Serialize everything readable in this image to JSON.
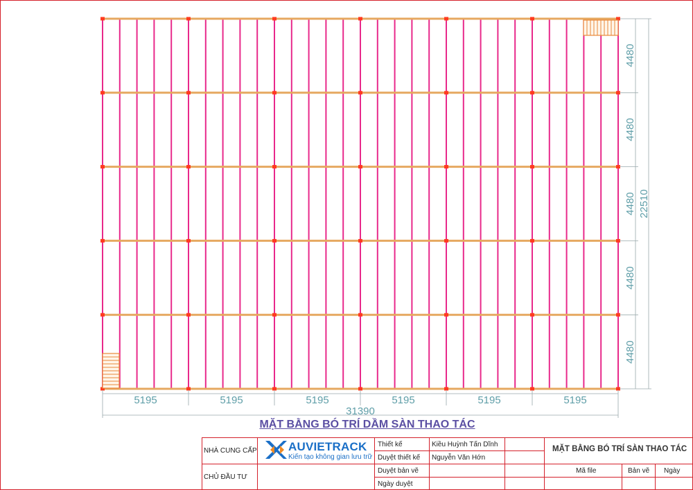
{
  "drawing": {
    "title": "MẶT BẰNG BÓ TRÍ DẦM SÀN THAO TÁC",
    "bay_widths": [
      "5195",
      "5195",
      "5195",
      "5195",
      "5195",
      "5195"
    ],
    "total_width": "31390",
    "row_heights": [
      "4480",
      "4480",
      "4480",
      "4480",
      "4480"
    ],
    "total_height": "22510",
    "colors": {
      "joist": "#e8288a",
      "beam": "#e6a860",
      "node": "#ff3b1f",
      "dimension": "#5f9ea8",
      "stair": "#e8883a"
    }
  },
  "title_block": {
    "supplier_label": "NHÀ CUNG CẤP",
    "investor_label": "CHỦ ĐẦU TƯ",
    "logo_name": "AUVIETRACK",
    "logo_tagline": "Kiến tạo không gian lưu trữ",
    "design_label": "Thiết kế",
    "design_value": "Kiều Huỳnh Tấn Dĩnh",
    "approve_design_label": "Duyệt thiết kế",
    "approve_design_value": "Nguyễn Văn Hớn",
    "approve_drawing_label": "Duyệt bản vẽ",
    "approve_date_label": "Ngày duyệt",
    "sheet_title": "MẶT BẰNG BÓ TRÍ SÀN THAO TÁC",
    "file_code_label": "Mã file",
    "revision_label": "Bản vẽ",
    "date_label": "Ngày"
  }
}
